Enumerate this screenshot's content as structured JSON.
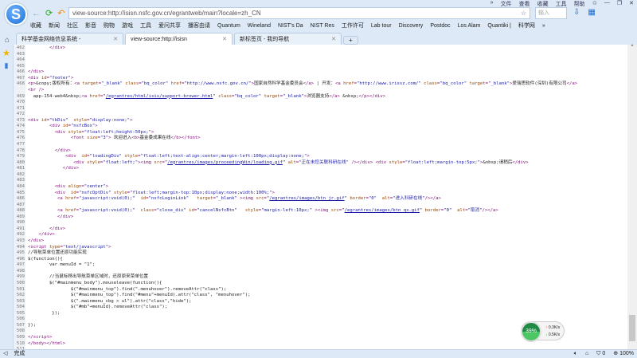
{
  "browser": {
    "top_menu": [
      "»",
      "文件",
      "查看",
      "收藏",
      "工具",
      "帮助"
    ],
    "window_controls": [
      "shirt",
      "—",
      "❐",
      "✕"
    ],
    "address": "view-source:http://isisn.nsfc.gov.cn/egrantweb/main?locale=zh_CN",
    "search_placeholder": "输入",
    "bookmarks": [
      "收藏",
      "新闻",
      "社区",
      "影音",
      "购物",
      "游戏",
      "工具",
      "爱问共享",
      "播客由请",
      "Quantum",
      "Wineland",
      "NIST's Da",
      "NIST Res",
      "工作许可",
      "Lab tour",
      "Discovery",
      "Postdoc",
      "Los Alam",
      "Quantiki |",
      "科学网",
      "»"
    ],
    "tabs": [
      {
        "label": "科学基金网络信息系统 -"
      },
      {
        "label": "view-source:http://isisn"
      },
      {
        "label": "新标签页 - 我的导航"
      }
    ],
    "status": "完成",
    "status_right": {
      "shield_count": "0",
      "zoom": "100%"
    },
    "net": {
      "percent": "39%",
      "up": "0.3K/s",
      "down": "0.5K/s"
    }
  },
  "code": [
    {
      "n": "462",
      "t": "        </div>"
    },
    {
      "n": "463",
      "t": ""
    },
    {
      "n": "464",
      "t": ""
    },
    {
      "n": "465",
      "t": ""
    },
    {
      "n": "466",
      "t": "</div>"
    },
    {
      "n": "467",
      "t": "<div id=\"footer\">"
    },
    {
      "n": "468",
      "t": "<p>&copy;版权所有：<a target=\"_blank\" class=\"bq_color\" href=\"http://www.nsfc.gov.cn/\">国家自然科学基金委员会</a> | 开发：<a href=\"http://www.irissz.com/\" class=\"bq_color\" target=\"_blank\">爱瑞思软件(深圳)有限公司</a>"
    },
    {
      "n": "",
      "t": "<br />"
    },
    {
      "n": "469",
      "t": "  app-154-web4&nbsp;<a href=\"/egrantres/html/isis/support-brower.html\" class=\"bq_color\" target=\"_blank\">浏览器支持</a> &nbsp;</p></div>"
    },
    {
      "n": "470",
      "t": ""
    },
    {
      "n": "471",
      "t": ""
    },
    {
      "n": "472",
      "t": ""
    },
    {
      "n": "473",
      "t": "<div id=\"tkDiv\"  style=\"display:none;\">"
    },
    {
      "n": "474",
      "t": "        <div id=\"nsfcBox\">"
    },
    {
      "n": "475",
      "t": "          <div style=\"float:left;height:50px;\">"
    },
    {
      "n": "476",
      "t": "                <font size=\"3\"> 欢迎进入<b>基金委成果在线</b></font>"
    },
    {
      "n": "477",
      "t": ""
    },
    {
      "n": "478",
      "t": "          </div>"
    },
    {
      "n": "479",
      "t": "              <div  id=\"loadingDiv\" style=\"float:left;text-align:center;margin-left:100px;display:none;\">"
    },
    {
      "n": "480",
      "t": "                 <div style=\"float:left;\"><img src=\"/egrantres/images/proceedingWin/loading.gif\" alt=\"正在未您关联科研在线\" /></div> <div style=\"float:left;margin-top:5px;\">&nbsp;请稍后</div>"
    },
    {
      "n": "481",
      "t": "             </div>"
    },
    {
      "n": "482",
      "t": ""
    },
    {
      "n": "483",
      "t": ""
    },
    {
      "n": "484",
      "t": "          <div align=\"center\">"
    },
    {
      "n": "485",
      "t": "          <div  id=\"nsfcOptDiv\" style=\"float:left;margin-top:10px;display:none;width:100%;\">"
    },
    {
      "n": "486",
      "t": "           <a href=\"javascript:void(0);\"  id=\"nsfcLoginLink\"   target=\"_blank\" ><img src=\"/egrantres/images/btn_jr.gif\" border=\"0\"  alt=\"进入科研在线\"/></a>"
    },
    {
      "n": "487",
      "t": ""
    },
    {
      "n": "488",
      "t": "           <a href=\"javascript:void(0);\"  class=\"close_div\" id=\"cancelNsfcBtn\"   style=\"margin-left:10px;\" ><img src=\"/egrantres/images/btn_qx.gif\" border=\"0\"  alt=\"取消\"/></a>"
    },
    {
      "n": "489",
      "t": "           </div>"
    },
    {
      "n": "490",
      "t": ""
    },
    {
      "n": "491",
      "t": "        </div>"
    },
    {
      "n": "492",
      "t": "    </div>"
    },
    {
      "n": "493",
      "t": "</div>"
    },
    {
      "n": "494",
      "t": "<script type=\"text/javascript\">"
    },
    {
      "n": "495",
      "t": "//导航菜单位置还原功能实现",
      "js": true
    },
    {
      "n": "496",
      "t": "$(function(){",
      "js": true
    },
    {
      "n": "497",
      "t": "        var menuId = \"1\";",
      "js": true
    },
    {
      "n": "498",
      "t": ""
    },
    {
      "n": "499",
      "t": "        //当鼠标移出导航菜单区域时，还原原来菜单位置",
      "js": true
    },
    {
      "n": "500",
      "t": "        $(\"#mainmenu_body\").mouseleave(function(){",
      "js": true
    },
    {
      "n": "501",
      "t": "                $(\"#mainmenu_top\").find(\".menuhover\").removeAttr(\"class\");",
      "js": true
    },
    {
      "n": "502",
      "t": "                $(\"#mainmenu_top\").find(\"#menu\"+menuId).attr(\"class\", \"menuhover\");",
      "js": true
    },
    {
      "n": "503",
      "t": "                $(\".mainmenu_cbg > ul\").attr(\"class\",\"hide\");",
      "js": true
    },
    {
      "n": "504",
      "t": "                $(\"#mb\"+menuId).removeAttr(\"class\");",
      "js": true
    },
    {
      "n": "505",
      "t": "         });",
      "js": true
    },
    {
      "n": "506",
      "t": ""
    },
    {
      "n": "507",
      "t": "});",
      "js": true
    },
    {
      "n": "508",
      "t": ""
    },
    {
      "n": "509",
      "t": "</script>"
    },
    {
      "n": "510",
      "t": "</body></html>"
    },
    {
      "n": "511",
      "t": ""
    }
  ]
}
